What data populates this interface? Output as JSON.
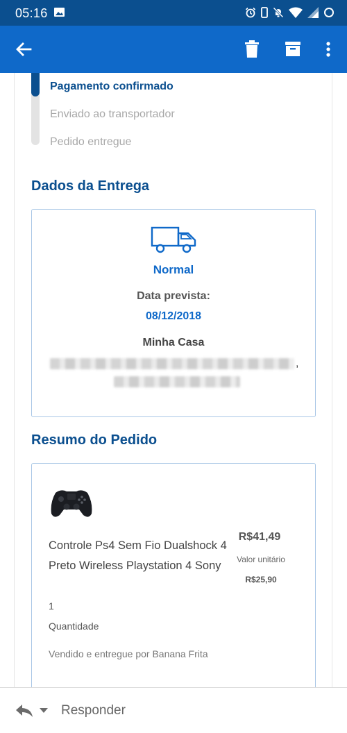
{
  "status_bar": {
    "time": "05:16",
    "icons": [
      "image-icon",
      "alarm-icon",
      "phone-icon",
      "bell-off-icon",
      "wifi-icon",
      "signal-icon",
      "battery-icon"
    ]
  },
  "app_bar": {
    "icons": [
      "back-arrow-icon",
      "trash-icon",
      "archive-icon",
      "more-vert-icon"
    ],
    "color": "#0f69c9"
  },
  "tracking": {
    "steps": [
      {
        "label": "Pagamento confirmado",
        "status": "done"
      },
      {
        "label": "Enviado ao transportador",
        "status": "pending"
      },
      {
        "label": "Pedido entregue",
        "status": "pending"
      }
    ]
  },
  "delivery": {
    "title": "Dados da Entrega",
    "method": "Normal",
    "date_label": "Data prevista:",
    "date_value": "08/12/2018",
    "place": "Minha Casa",
    "address_comma": ","
  },
  "summary": {
    "title": "Resumo do Pedido",
    "product": {
      "name": "Controle Ps4 Sem Fio Dualshock 4 Preto Wireless Playstation 4 Sony",
      "price": "R$41,49",
      "unit_label": "Valor unitário",
      "unit_value": "R$25,90",
      "quantity": "1",
      "quantity_label": "Quantidade",
      "seller": "Vendido e entregue por Banana Frita"
    }
  },
  "reply_bar": {
    "label": "Responder"
  },
  "colors": {
    "brand_dark": "#0b4f8f",
    "brand": "#0f69c9",
    "card_border": "#a9c7e6"
  }
}
